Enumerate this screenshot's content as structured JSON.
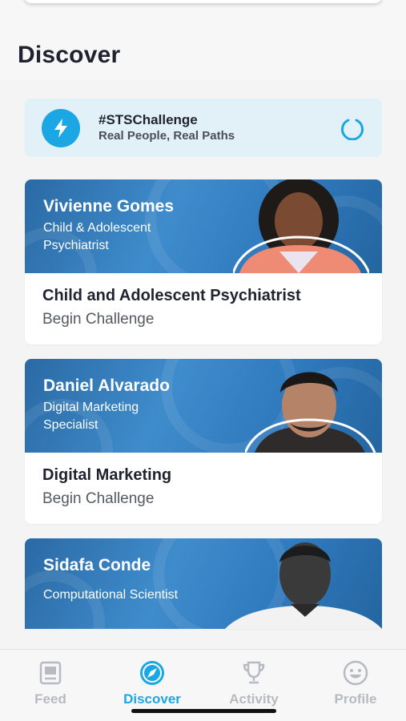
{
  "header": {
    "title": "Discover"
  },
  "banner": {
    "icon": "lightning-icon",
    "title": "#STSChallenge",
    "subtitle": "Real People, Real Paths",
    "spinner_icon": "loading-spinner-icon"
  },
  "cards": [
    {
      "name": "Vivienne Gomes",
      "role": "Child & Adolescent Psychiatrist",
      "title": "Child and Adolescent Psychiatrist",
      "action": "Begin Challenge"
    },
    {
      "name": "Daniel Alvarado",
      "role": "Digital Marketing Specialist",
      "title": "Digital Marketing",
      "action": "Begin Challenge"
    },
    {
      "name": "Sidafa Conde",
      "role": "Computational Scientist"
    }
  ],
  "tabs": [
    {
      "label": "Feed",
      "icon": "feed-icon",
      "active": false
    },
    {
      "label": "Discover",
      "icon": "compass-icon",
      "active": true
    },
    {
      "label": "Activity",
      "icon": "trophy-icon",
      "active": false
    },
    {
      "label": "Profile",
      "icon": "smiley-icon",
      "active": false
    }
  ],
  "colors": {
    "accent": "#1ba6e4",
    "banner_bg": "#e2f0f8",
    "card_blue": "#2f79bd",
    "text_dark": "#1f2330",
    "tab_inactive": "#b7bac1"
  }
}
